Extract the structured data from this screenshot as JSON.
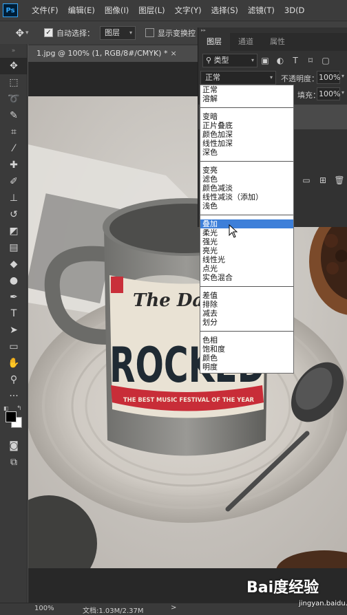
{
  "menu": {
    "app_icon": "Ps",
    "items": [
      "文件(F)",
      "编辑(E)",
      "图像(I)",
      "图层(L)",
      "文字(Y)",
      "选择(S)",
      "滤镜(T)",
      "3D(D"
    ]
  },
  "options_bar": {
    "move_tool_icon": "move-icon",
    "auto_select_label": "自动选择：",
    "auto_select_checked": true,
    "auto_select_target": "图层",
    "show_transform_label": "显示变换控",
    "show_transform_checked": false
  },
  "document": {
    "tab_title": "1.jpg @ 100% (1, RGB/8#/CMYK) *",
    "close_glyph": "×"
  },
  "canvas_image": {
    "mug_text_top": "The Daily",
    "mug_text_main": "ROCKED",
    "mug_text_banner": "THE BEST MUSIC FESTIVAL OF THE YEAR"
  },
  "panel": {
    "tabs": [
      "图层",
      "通道",
      "属性"
    ],
    "active_tab": 0,
    "filter_kind": "类型",
    "blend_mode_current": "正常",
    "opacity_label": "不透明度：",
    "opacity_value": "100%",
    "fill_label": "填充：",
    "fill_value": "100%"
  },
  "blend_dropdown": {
    "groups": [
      [
        "正常",
        "溶解"
      ],
      [
        "变暗",
        "正片叠底",
        "颜色加深",
        "线性加深",
        "深色"
      ],
      [
        "变亮",
        "滤色",
        "颜色减淡",
        "线性减淡（添加）",
        "浅色"
      ],
      [
        "叠加",
        "柔光",
        "强光",
        "亮光",
        "线性光",
        "点光",
        "实色混合"
      ],
      [
        "差值",
        "排除",
        "减去",
        "划分"
      ],
      [
        "色相",
        "饱和度",
        "颜色",
        "明度"
      ]
    ],
    "highlighted": "叠加"
  },
  "status_bar": {
    "zoom": "100%",
    "doc_size": "文档:1.03M/2.37M",
    "arrow": ">"
  },
  "watermark": {
    "brand": "Bai度经验",
    "url": "jingyan.baidu.com"
  },
  "colors": {
    "highlight": "#3d7fd9",
    "foreground": "#000000",
    "background": "#ffffff"
  }
}
